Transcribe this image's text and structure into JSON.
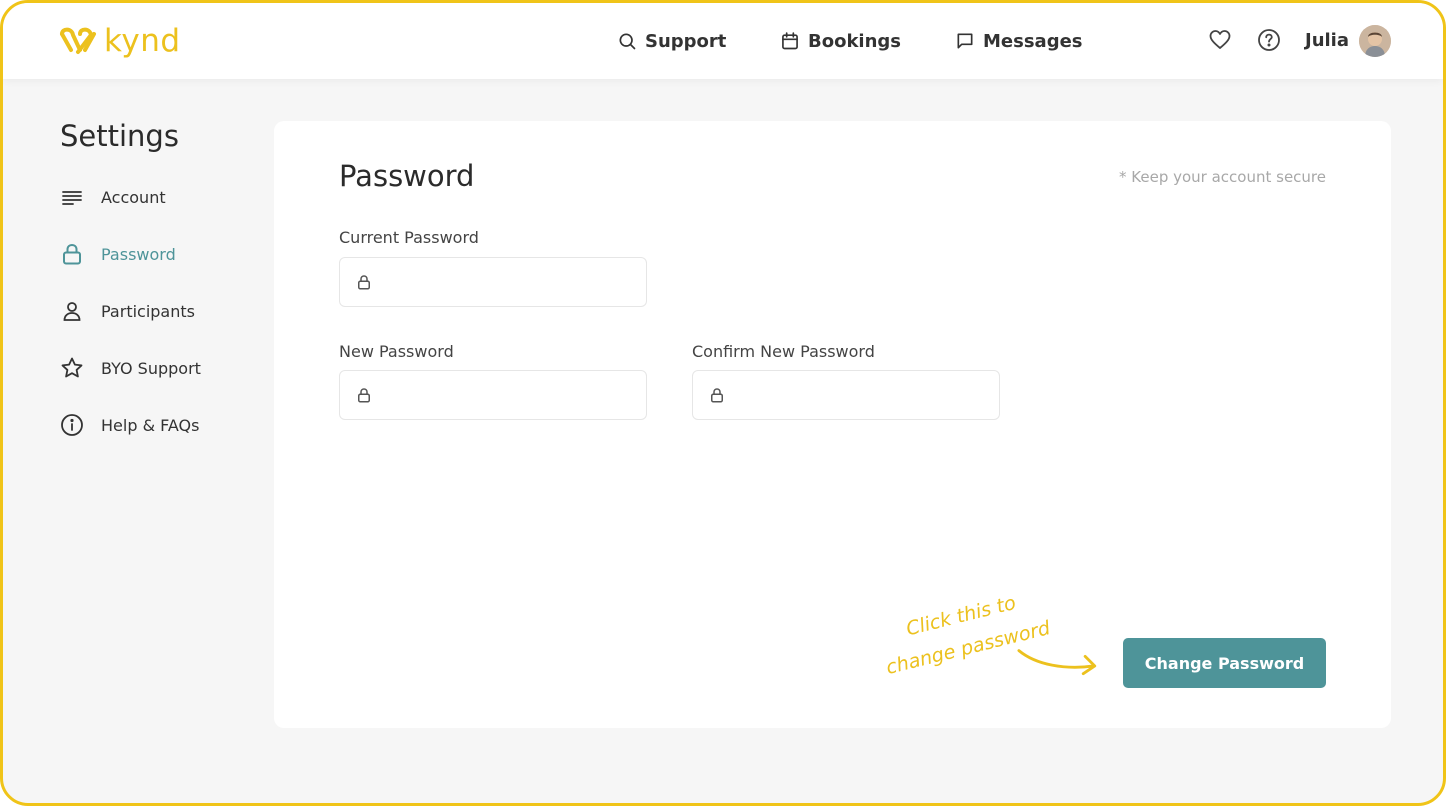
{
  "app": {
    "logo_text": "kynd"
  },
  "nav": [
    {
      "label": "Support",
      "icon": "search-icon"
    },
    {
      "label": "Bookings",
      "icon": "calendar-icon"
    },
    {
      "label": "Messages",
      "icon": "message-icon"
    }
  ],
  "header": {
    "user_name": "Julia"
  },
  "sidebar": {
    "title": "Settings",
    "items": [
      {
        "label": "Account",
        "icon": "lines-icon",
        "active": false
      },
      {
        "label": "Password",
        "icon": "lock-icon",
        "active": true
      },
      {
        "label": "Participants",
        "icon": "user-icon",
        "active": false
      },
      {
        "label": "BYO Support",
        "icon": "star-icon",
        "active": false
      },
      {
        "label": "Help & FAQs",
        "icon": "info-icon",
        "active": false
      }
    ]
  },
  "main": {
    "title": "Password",
    "note": "* Keep your account secure",
    "fields": {
      "current": {
        "label": "Current Password",
        "value": ""
      },
      "new": {
        "label": "New Password",
        "value": ""
      },
      "confirm": {
        "label": "Confirm New Password",
        "value": ""
      }
    },
    "button_label": "Change Password",
    "annotation": [
      "Click this to",
      "change password"
    ]
  },
  "colors": {
    "brand": "#ecc11e",
    "accent": "#4e9499",
    "frame": "#f0c418"
  }
}
